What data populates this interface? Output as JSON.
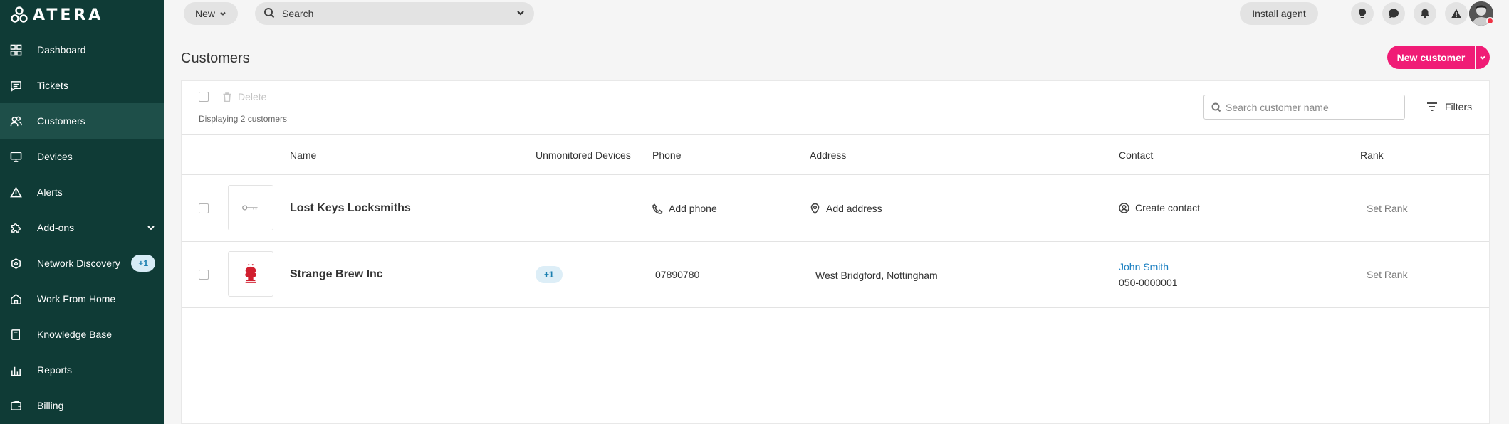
{
  "brand": {
    "name": "ATERA"
  },
  "sidebar": {
    "items": [
      {
        "label": "Dashboard",
        "icon": "dashboard-icon"
      },
      {
        "label": "Tickets",
        "icon": "ticket-icon"
      },
      {
        "label": "Customers",
        "icon": "customers-icon",
        "active": true
      },
      {
        "label": "Devices",
        "icon": "monitor-icon"
      },
      {
        "label": "Alerts",
        "icon": "warning-icon"
      },
      {
        "label": "Add-ons",
        "icon": "puzzle-icon"
      },
      {
        "label": "Network Discovery",
        "icon": "network-icon",
        "badge": "+1"
      },
      {
        "label": "Work From Home",
        "icon": "home-icon"
      },
      {
        "label": "Knowledge Base",
        "icon": "book-icon"
      },
      {
        "label": "Reports",
        "icon": "chart-icon"
      },
      {
        "label": "Billing",
        "icon": "wallet-icon"
      }
    ]
  },
  "topbar": {
    "new_label": "New",
    "search_label": "Search",
    "install_label": "Install agent"
  },
  "page": {
    "title": "Customers",
    "new_customer_label": "New customer"
  },
  "toolbar": {
    "delete_label": "Delete",
    "displaying": "Displaying 2 customers",
    "search_placeholder": "Search customer name",
    "filters_label": "Filters"
  },
  "table": {
    "columns": [
      "Name",
      "Unmonitored Devices",
      "Phone",
      "Address",
      "Contact",
      "Rank"
    ],
    "rows": [
      {
        "name": "Lost Keys Locksmiths",
        "unmonitored": "",
        "phone": "Add phone",
        "address": "Add address",
        "contact_action": "Create contact",
        "rank": "Set Rank"
      },
      {
        "name": "Strange Brew Inc",
        "unmonitored": "+1",
        "phone": "07890780",
        "address": "West Bridgford, Nottingham",
        "contact_name": "John Smith",
        "contact_phone": "050-0000001",
        "rank": "Set Rank"
      }
    ]
  },
  "colors": {
    "sidebar": "#0f3b36",
    "accent": "#f01c76",
    "link": "#1a7fc1"
  }
}
